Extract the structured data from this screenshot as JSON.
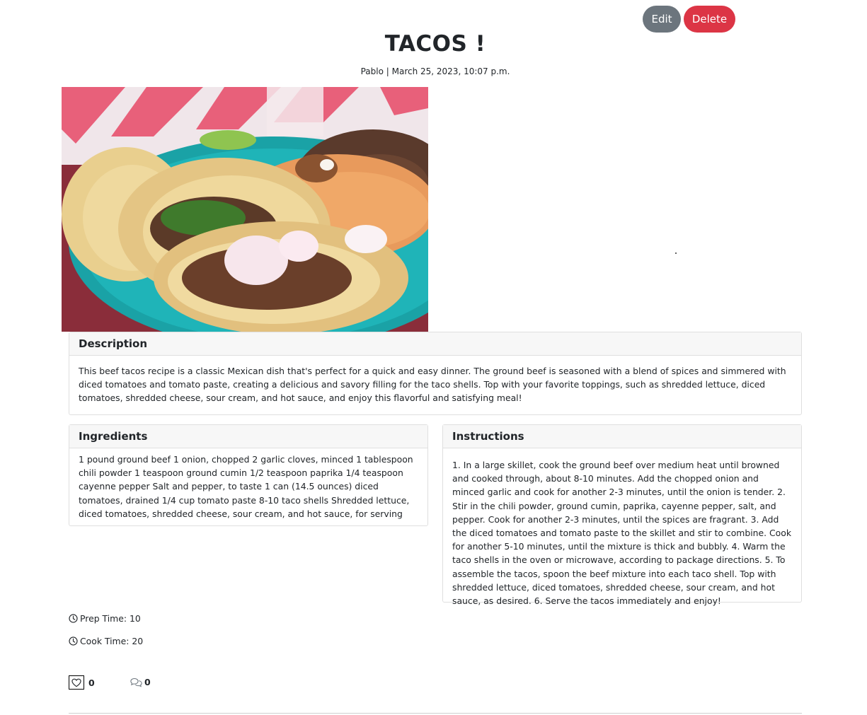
{
  "actions": {
    "edit_label": "Edit",
    "delete_label": "Delete"
  },
  "post": {
    "title": "TACOS !",
    "meta": "Pablo | March 25, 2023, 10:07 p.m.",
    "image_alt": "Plate of beef tacos with rice and beans"
  },
  "description": {
    "header": "Description",
    "body": "This beef tacos recipe is a classic Mexican dish that's perfect for a quick and easy dinner. The ground beef is seasoned with a blend of spices and simmered with diced tomatoes and tomato paste, creating a delicious and savory filling for the taco shells. Top with your favorite toppings, such as shredded lettuce, diced tomatoes, shredded cheese, sour cream, and hot sauce, and enjoy this flavorful and satisfying meal!"
  },
  "ingredients": {
    "header": "Ingredients",
    "body": "1 pound ground beef 1 onion, chopped 2 garlic cloves, minced 1 tablespoon chili powder 1 teaspoon ground cumin 1/2 teaspoon paprika 1/4 teaspoon cayenne pepper Salt and pepper, to taste 1 can (14.5 ounces) diced tomatoes, drained 1/4 cup tomato paste 8-10 taco shells Shredded lettuce, diced tomatoes, shredded cheese, sour cream, and hot sauce, for serving"
  },
  "instructions": {
    "header": "Instructions",
    "body": "1. In a large skillet, cook the ground beef over medium heat until browned and cooked through, about 8-10 minutes. Add the chopped onion and minced garlic and cook for another 2-3 minutes, until the onion is tender. 2. Stir in the chili powder, ground cumin, paprika, cayenne pepper, salt, and pepper. Cook for another 2-3 minutes, until the spices are fragrant. 3. Add the diced tomatoes and tomato paste to the skillet and stir to combine. Cook for another 5-10 minutes, until the mixture is thick and bubbly. 4. Warm the taco shells in the oven or microwave, according to package directions. 5. To assemble the tacos, spoon the beef mixture into each taco shell. Top with shredded lettuce, diced tomatoes, shredded cheese, sour cream, and hot sauce, as desired. 6. Serve the tacos immediately and enjoy!"
  },
  "times": {
    "prep": "Prep Time: 10",
    "cook": "Cook Time: 20"
  },
  "engagement": {
    "likes": "0",
    "comments": "0"
  },
  "icons": {
    "clock": "clock-icon",
    "heart": "heart-icon",
    "comments": "comments-icon"
  },
  "colors": {
    "edit": "#6c757d",
    "delete": "#dc3545"
  }
}
